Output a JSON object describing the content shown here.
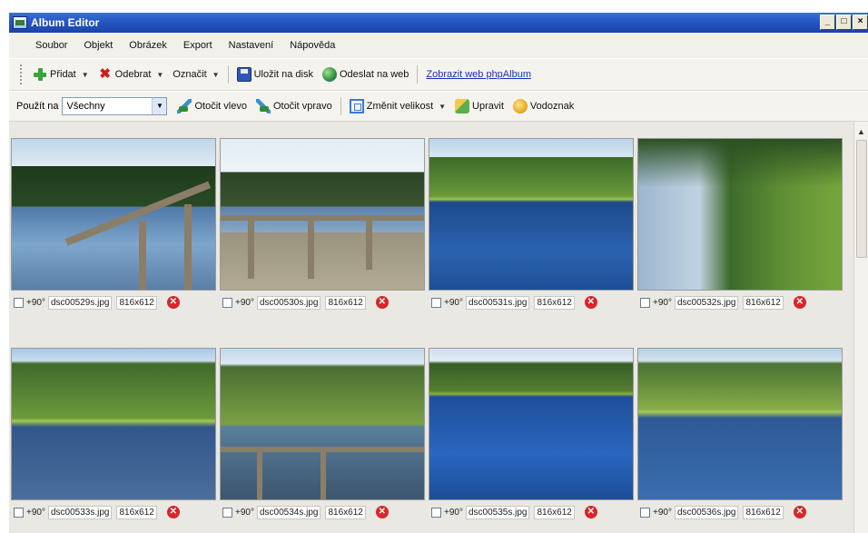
{
  "window": {
    "title": "Album Editor",
    "controls": [
      "_",
      "□",
      "×"
    ]
  },
  "menu": [
    "Soubor",
    "Objekt",
    "Obrázek",
    "Export",
    "Nastavení",
    "Nápověda"
  ],
  "toolbar1": {
    "add": "Přidat",
    "remove": "Odebrat",
    "mark": "Označit",
    "save": "Uložit na disk",
    "send": "Odeslat na web",
    "view_web": "Zobrazit web phpAlbum"
  },
  "toolbar2": {
    "apply_to_label": "Použít na",
    "apply_to_value": "Všechny",
    "rotate_left": "Otočit vlevo",
    "rotate_right": "Otočit vpravo",
    "resize": "Změnit velikost",
    "edit": "Upravit",
    "watermark": "Vodoznak"
  },
  "photos": [
    {
      "rotate": "+90°",
      "file": "dsc00529s.jpg",
      "dims": "816x612"
    },
    {
      "rotate": "+90°",
      "file": "dsc00530s.jpg",
      "dims": "816x612"
    },
    {
      "rotate": "+90°",
      "file": "dsc00531s.jpg",
      "dims": "816x612"
    },
    {
      "rotate": "+90°",
      "file": "dsc00532s.jpg",
      "dims": "816x612"
    },
    {
      "rotate": "+90°",
      "file": "dsc00533s.jpg",
      "dims": "816x612"
    },
    {
      "rotate": "+90°",
      "file": "dsc00534s.jpg",
      "dims": "816x612"
    },
    {
      "rotate": "+90°",
      "file": "dsc00535s.jpg",
      "dims": "816x612"
    },
    {
      "rotate": "+90°",
      "file": "dsc00536s.jpg",
      "dims": "816x612"
    }
  ],
  "icons": {
    "add": "plus-icon",
    "remove": "x-icon",
    "save": "floppy-icon",
    "send": "globe-icon",
    "rotate_left": "rotate-left-icon",
    "rotate_right": "rotate-right-icon",
    "resize": "resize-icon",
    "edit": "edit-icon",
    "watermark": "watermark-icon",
    "delete": "delete-icon"
  },
  "colors": {
    "titlebar": "#2456c4",
    "link": "#1a2fb8",
    "delete": "#d8262a"
  }
}
